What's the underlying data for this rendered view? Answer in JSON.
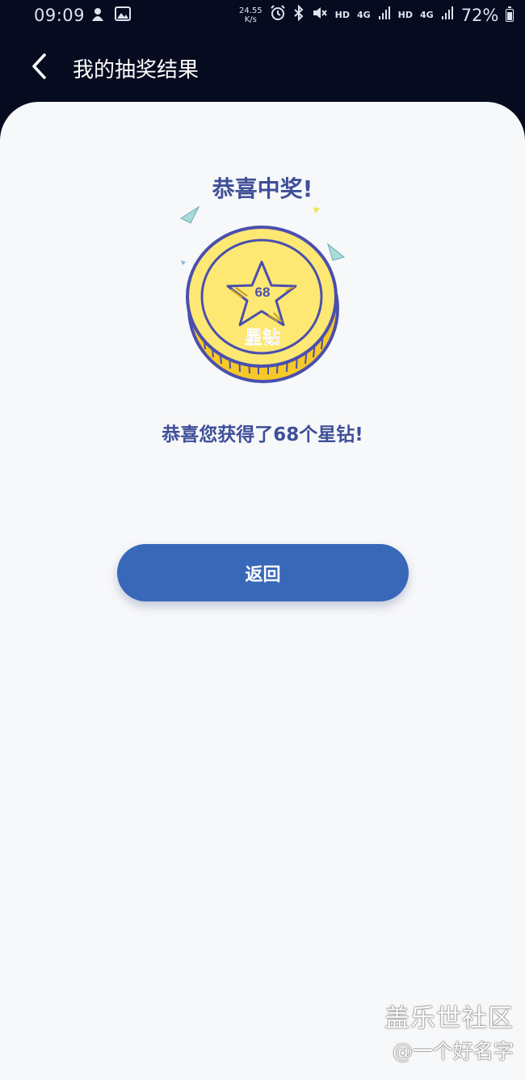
{
  "status_bar": {
    "time": "09:09",
    "net_speed_value": "24.55",
    "net_speed_unit": "K/s",
    "hd1": "HD",
    "net1": "4G",
    "hd2": "HD",
    "net2": "4G",
    "battery": "72%",
    "icons": [
      "notification-icon",
      "image-icon",
      "alarm-icon",
      "bluetooth-icon",
      "mute-icon",
      "signal-icon",
      "battery-icon"
    ]
  },
  "header": {
    "title": "我的抽奖结果"
  },
  "result": {
    "heading": "恭喜中奖!",
    "coin_amount": "68",
    "coin_label": "星钻",
    "message": "恭喜您获得了68个星钻!"
  },
  "actions": {
    "return_label": "返回"
  },
  "watermark": {
    "line1": "盖乐世社区",
    "line2": "@一个好名字"
  },
  "colors": {
    "header_bg": "#070b1f",
    "card_bg": "#f7f8fa",
    "accent_text": "#3f4f98",
    "button_bg": "#3a68b9",
    "coin_yellow": "#fde873",
    "coin_outline": "#4a4fae"
  }
}
